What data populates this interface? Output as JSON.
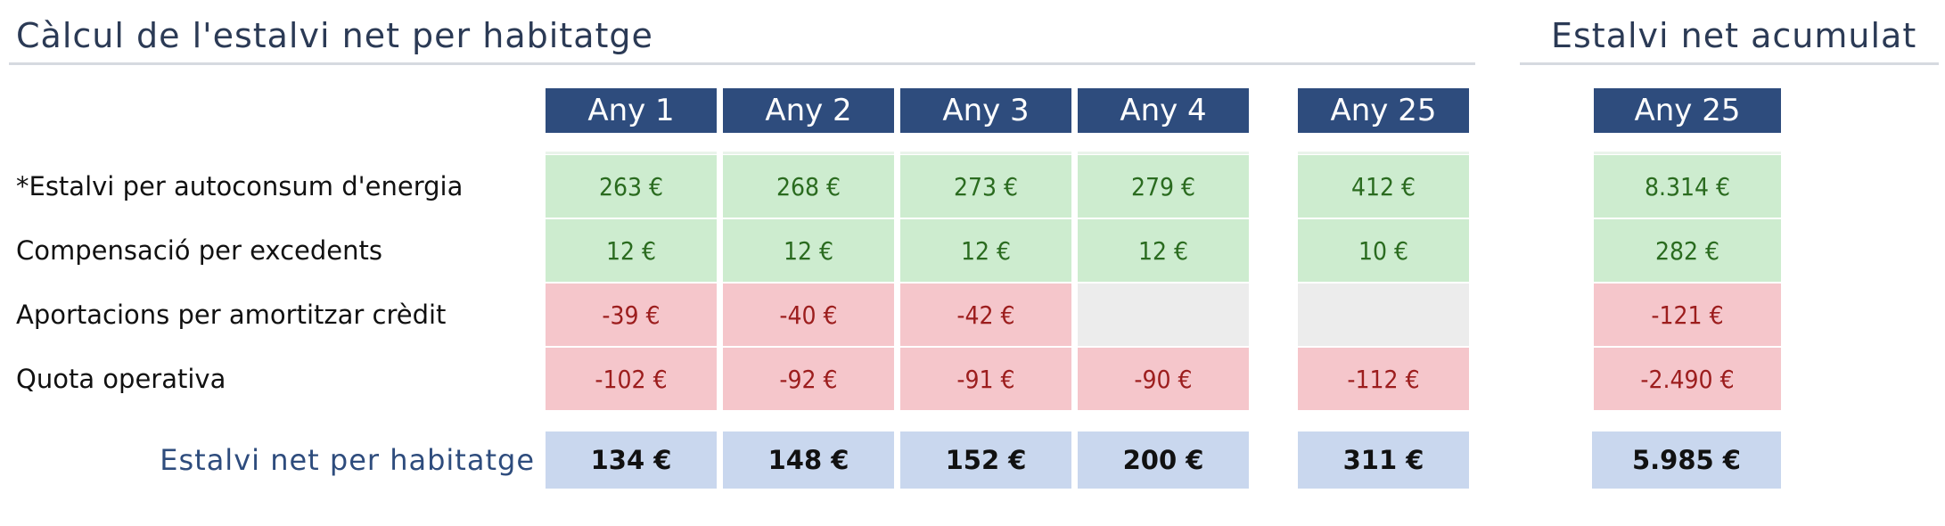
{
  "titles": {
    "left": "Càlcul de l'estalvi net per habitatge",
    "right": "Estalvi net acumulat"
  },
  "columns": [
    "Any 1",
    "Any 2",
    "Any 3",
    "Any 4",
    "Any 25"
  ],
  "cumulative_column": "Any 25",
  "rows": [
    {
      "label": "*Estalvi per autoconsum d'energia",
      "tone": "positive",
      "values": [
        "263 €",
        "268 €",
        "273 €",
        "279 €",
        "412 €"
      ],
      "cumulative": "8.314 €"
    },
    {
      "label": "Compensació per excedents",
      "tone": "positive",
      "values": [
        "12 €",
        "12 €",
        "12 €",
        "12 €",
        "10 €"
      ],
      "cumulative": "282 €"
    },
    {
      "label": "Aportacions per amortitzar crèdit",
      "tone": "negative",
      "values": [
        "-39 €",
        "-40 €",
        "-42 €",
        "",
        ""
      ],
      "cumulative": "-121 €"
    },
    {
      "label": "Quota operativa",
      "tone": "negative",
      "values": [
        "-102 €",
        "-92 €",
        "-91 €",
        "-90 €",
        "-112 €"
      ],
      "cumulative": "-2.490 €"
    }
  ],
  "total": {
    "label": "Estalvi net per habitatge",
    "values": [
      "134 €",
      "148 €",
      "152 €",
      "200 €",
      "311 €"
    ],
    "cumulative": "5.985 €"
  }
}
